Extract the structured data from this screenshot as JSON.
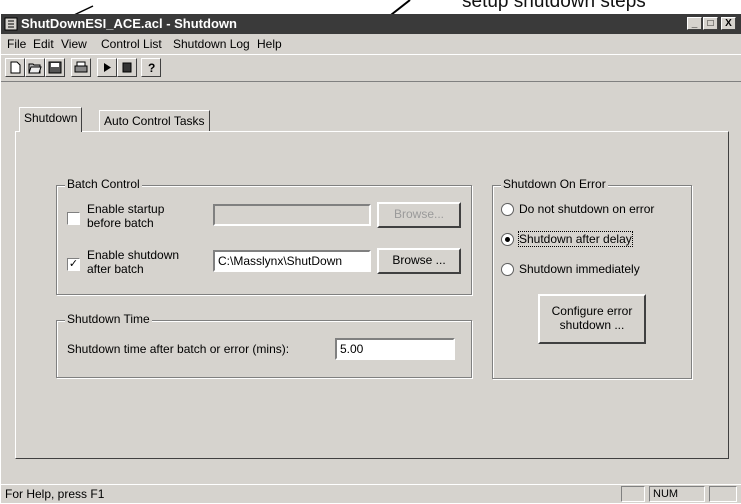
{
  "annotation": {
    "text": "setup shutdown steps"
  },
  "window": {
    "title": "ShutDownESI_ACE.acl - Shutdown",
    "controls": [
      "_",
      "□",
      "X"
    ]
  },
  "menu": [
    "File",
    "Edit",
    "View",
    "Control List",
    "Shutdown Log",
    "Help"
  ],
  "toolbar": {
    "icons": [
      "new-icon",
      "open-icon",
      "save-icon",
      "print-icon",
      "run-icon",
      "stop-icon",
      "help-icon"
    ]
  },
  "tabs": [
    "Shutdown",
    "Auto Control Tasks"
  ],
  "batch_control": {
    "title": "Batch Control",
    "startup": {
      "label_line1": "Enable startup",
      "label_line2": "before batch",
      "checked": false,
      "path": "",
      "browse": "Browse..."
    },
    "shutdown": {
      "label_line1": "Enable shutdown",
      "label_line2": "after batch",
      "checked": true,
      "path": "C:\\Masslynx\\ShutDown",
      "browse": "Browse ..."
    }
  },
  "shutdown_time": {
    "title": "Shutdown Time",
    "label": "Shutdown time after batch or error (mins):",
    "value": "5.00"
  },
  "shutdown_on_error": {
    "title": "Shutdown On Error",
    "options": [
      "Do not shutdown on error",
      "Shutdown after delay",
      "Shutdown immediately"
    ],
    "selected": "Shutdown after delay",
    "configure_line1": "Configure error",
    "configure_line2": "shutdown ..."
  },
  "status": {
    "text": "For Help, press F1",
    "num": "NUM"
  }
}
